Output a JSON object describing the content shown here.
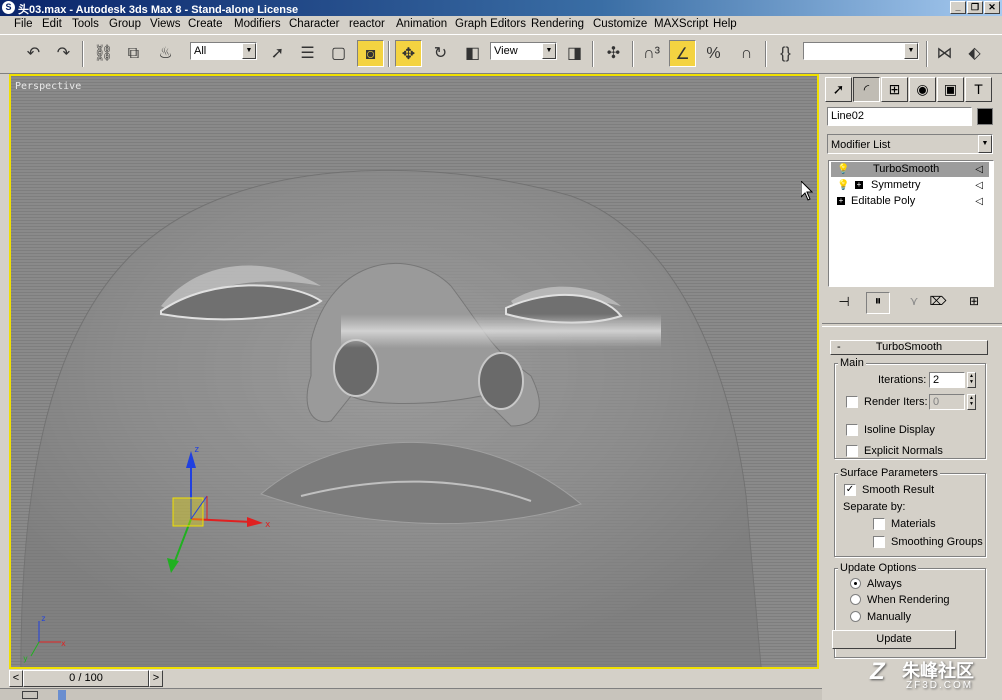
{
  "window": {
    "title": "头03.max - Autodesk 3ds Max 8 - Stand-alone License",
    "app_icon": "3ds-max-logo-icon"
  },
  "menu": [
    "File",
    "Edit",
    "Tools",
    "Group",
    "Views",
    "Create",
    "Modifiers",
    "Character",
    "reactor",
    "Animation",
    "Graph Editors",
    "Rendering",
    "Customize",
    "MAXScript",
    "Help"
  ],
  "toolbar": {
    "selection_filter": "All",
    "reference_coord": "View",
    "named_selection": ""
  },
  "viewport": {
    "label": "Perspective",
    "axis_x": "x",
    "axis_y": "y",
    "axis_z": "z",
    "gizmo_colors": {
      "x": "#e02020",
      "y": "#20b020",
      "z": "#2040e0"
    }
  },
  "command_panel": {
    "object_name": "Line02",
    "object_color": "#000000",
    "modifier_list_label": "Modifier List",
    "stack": [
      {
        "label": "TurboSmooth",
        "selected": true
      },
      {
        "label": "Symmetry",
        "selected": false
      },
      {
        "label": "Editable Poly",
        "selected": false
      }
    ],
    "rollout": {
      "title": "TurboSmooth",
      "main": {
        "group_label": "Main",
        "iterations_label": "Iterations:",
        "iterations_value": "2",
        "render_iters_label": "Render Iters:",
        "render_iters_value": "0",
        "isoline_label": "Isoline Display",
        "explicit_normals_label": "Explicit Normals"
      },
      "surface": {
        "group_label": "Surface Parameters",
        "smooth_result_label": "Smooth Result",
        "separate_by_label": "Separate by:",
        "materials_label": "Materials",
        "smoothing_groups_label": "Smoothing Groups"
      },
      "update": {
        "group_label": "Update Options",
        "always_label": "Always",
        "when_rendering_label": "When Rendering",
        "manually_label": "Manually",
        "update_button": "Update"
      }
    }
  },
  "timeline": {
    "frame_display": "0 / 100"
  },
  "watermark": {
    "line1": "朱峰社区",
    "line2": "ZF3D.COM"
  }
}
